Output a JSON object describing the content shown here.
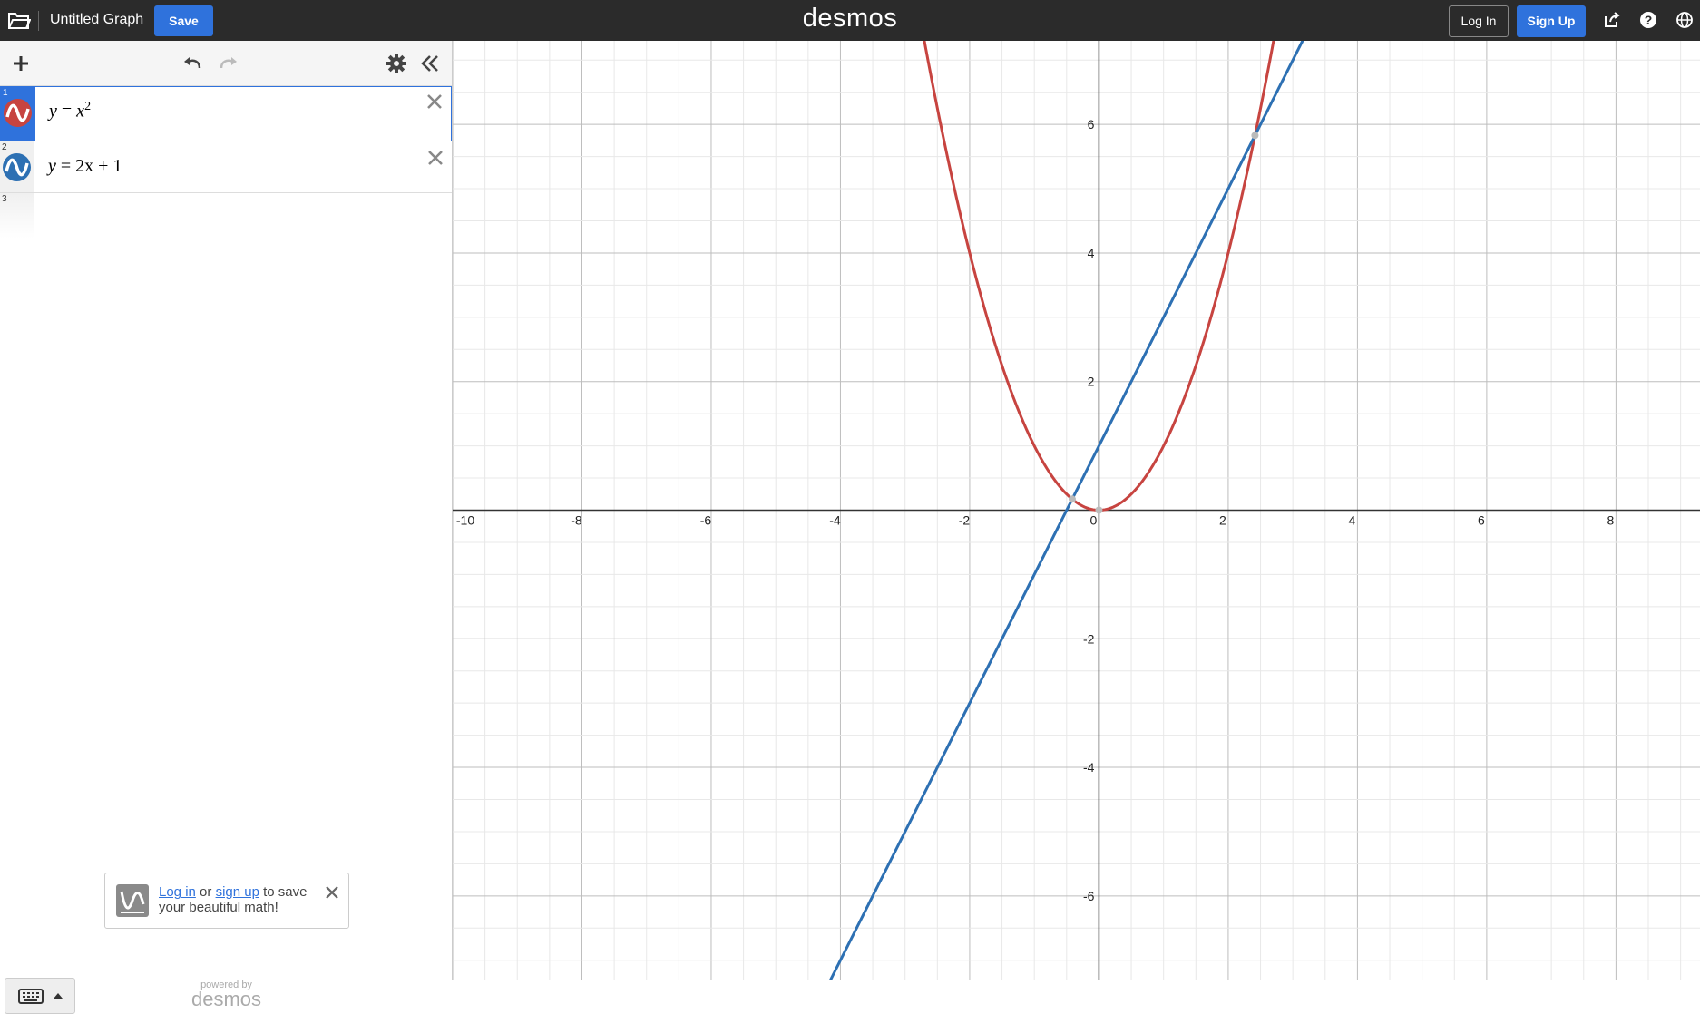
{
  "header": {
    "graph_title": "Untitled Graph",
    "save_label": "Save",
    "logo": "desmos",
    "login_label": "Log In",
    "signup_label": "Sign Up",
    "icons": [
      "folder-icon",
      "share-icon",
      "help-icon",
      "globe-icon"
    ]
  },
  "toolbar": {
    "icons": [
      "add-icon",
      "undo-icon",
      "redo-icon",
      "gear-icon",
      "collapse-icon"
    ]
  },
  "expressions": [
    {
      "num": "1",
      "color": "#c74440",
      "math_lhs": "y",
      "math_eq": "=",
      "math_base": "x",
      "math_exp": "2"
    },
    {
      "num": "2",
      "color": "#2d70b3",
      "math_lhs": "y",
      "math_eq": "=",
      "math_rhs": "2x + 1"
    },
    {
      "num": "3"
    }
  ],
  "promo": {
    "login_link": "Log in",
    "or_text": " or ",
    "signup_link": "sign up",
    "rest_line1": " to save",
    "line2": "your beautiful math!"
  },
  "powered": {
    "small": "powered by",
    "big": "desmos"
  },
  "colors": {
    "accent": "#2f72dc",
    "curve_red": "#c74440",
    "curve_blue": "#2d70b3",
    "header_bg": "#2b2b2b"
  },
  "chart_data": {
    "type": "line",
    "xlim": [
      -10,
      9.3
    ],
    "ylim": [
      -7.3,
      7.3
    ],
    "grid": true,
    "x_ticks": [
      "-10",
      "-8",
      "-6",
      "-4",
      "-2",
      "0",
      "2",
      "4",
      "6",
      "8"
    ],
    "y_ticks": [
      "6",
      "4",
      "2",
      "-2",
      "-4",
      "-6"
    ],
    "series": [
      {
        "expression": "y=x^2",
        "color": "#c74440"
      },
      {
        "expression": "y=2x+1",
        "color": "#2d70b3"
      }
    ],
    "points": [
      {
        "x": -0.414,
        "y": 0.172
      },
      {
        "x": 0,
        "y": 0
      },
      {
        "x": 2.414,
        "y": 5.828
      }
    ]
  }
}
